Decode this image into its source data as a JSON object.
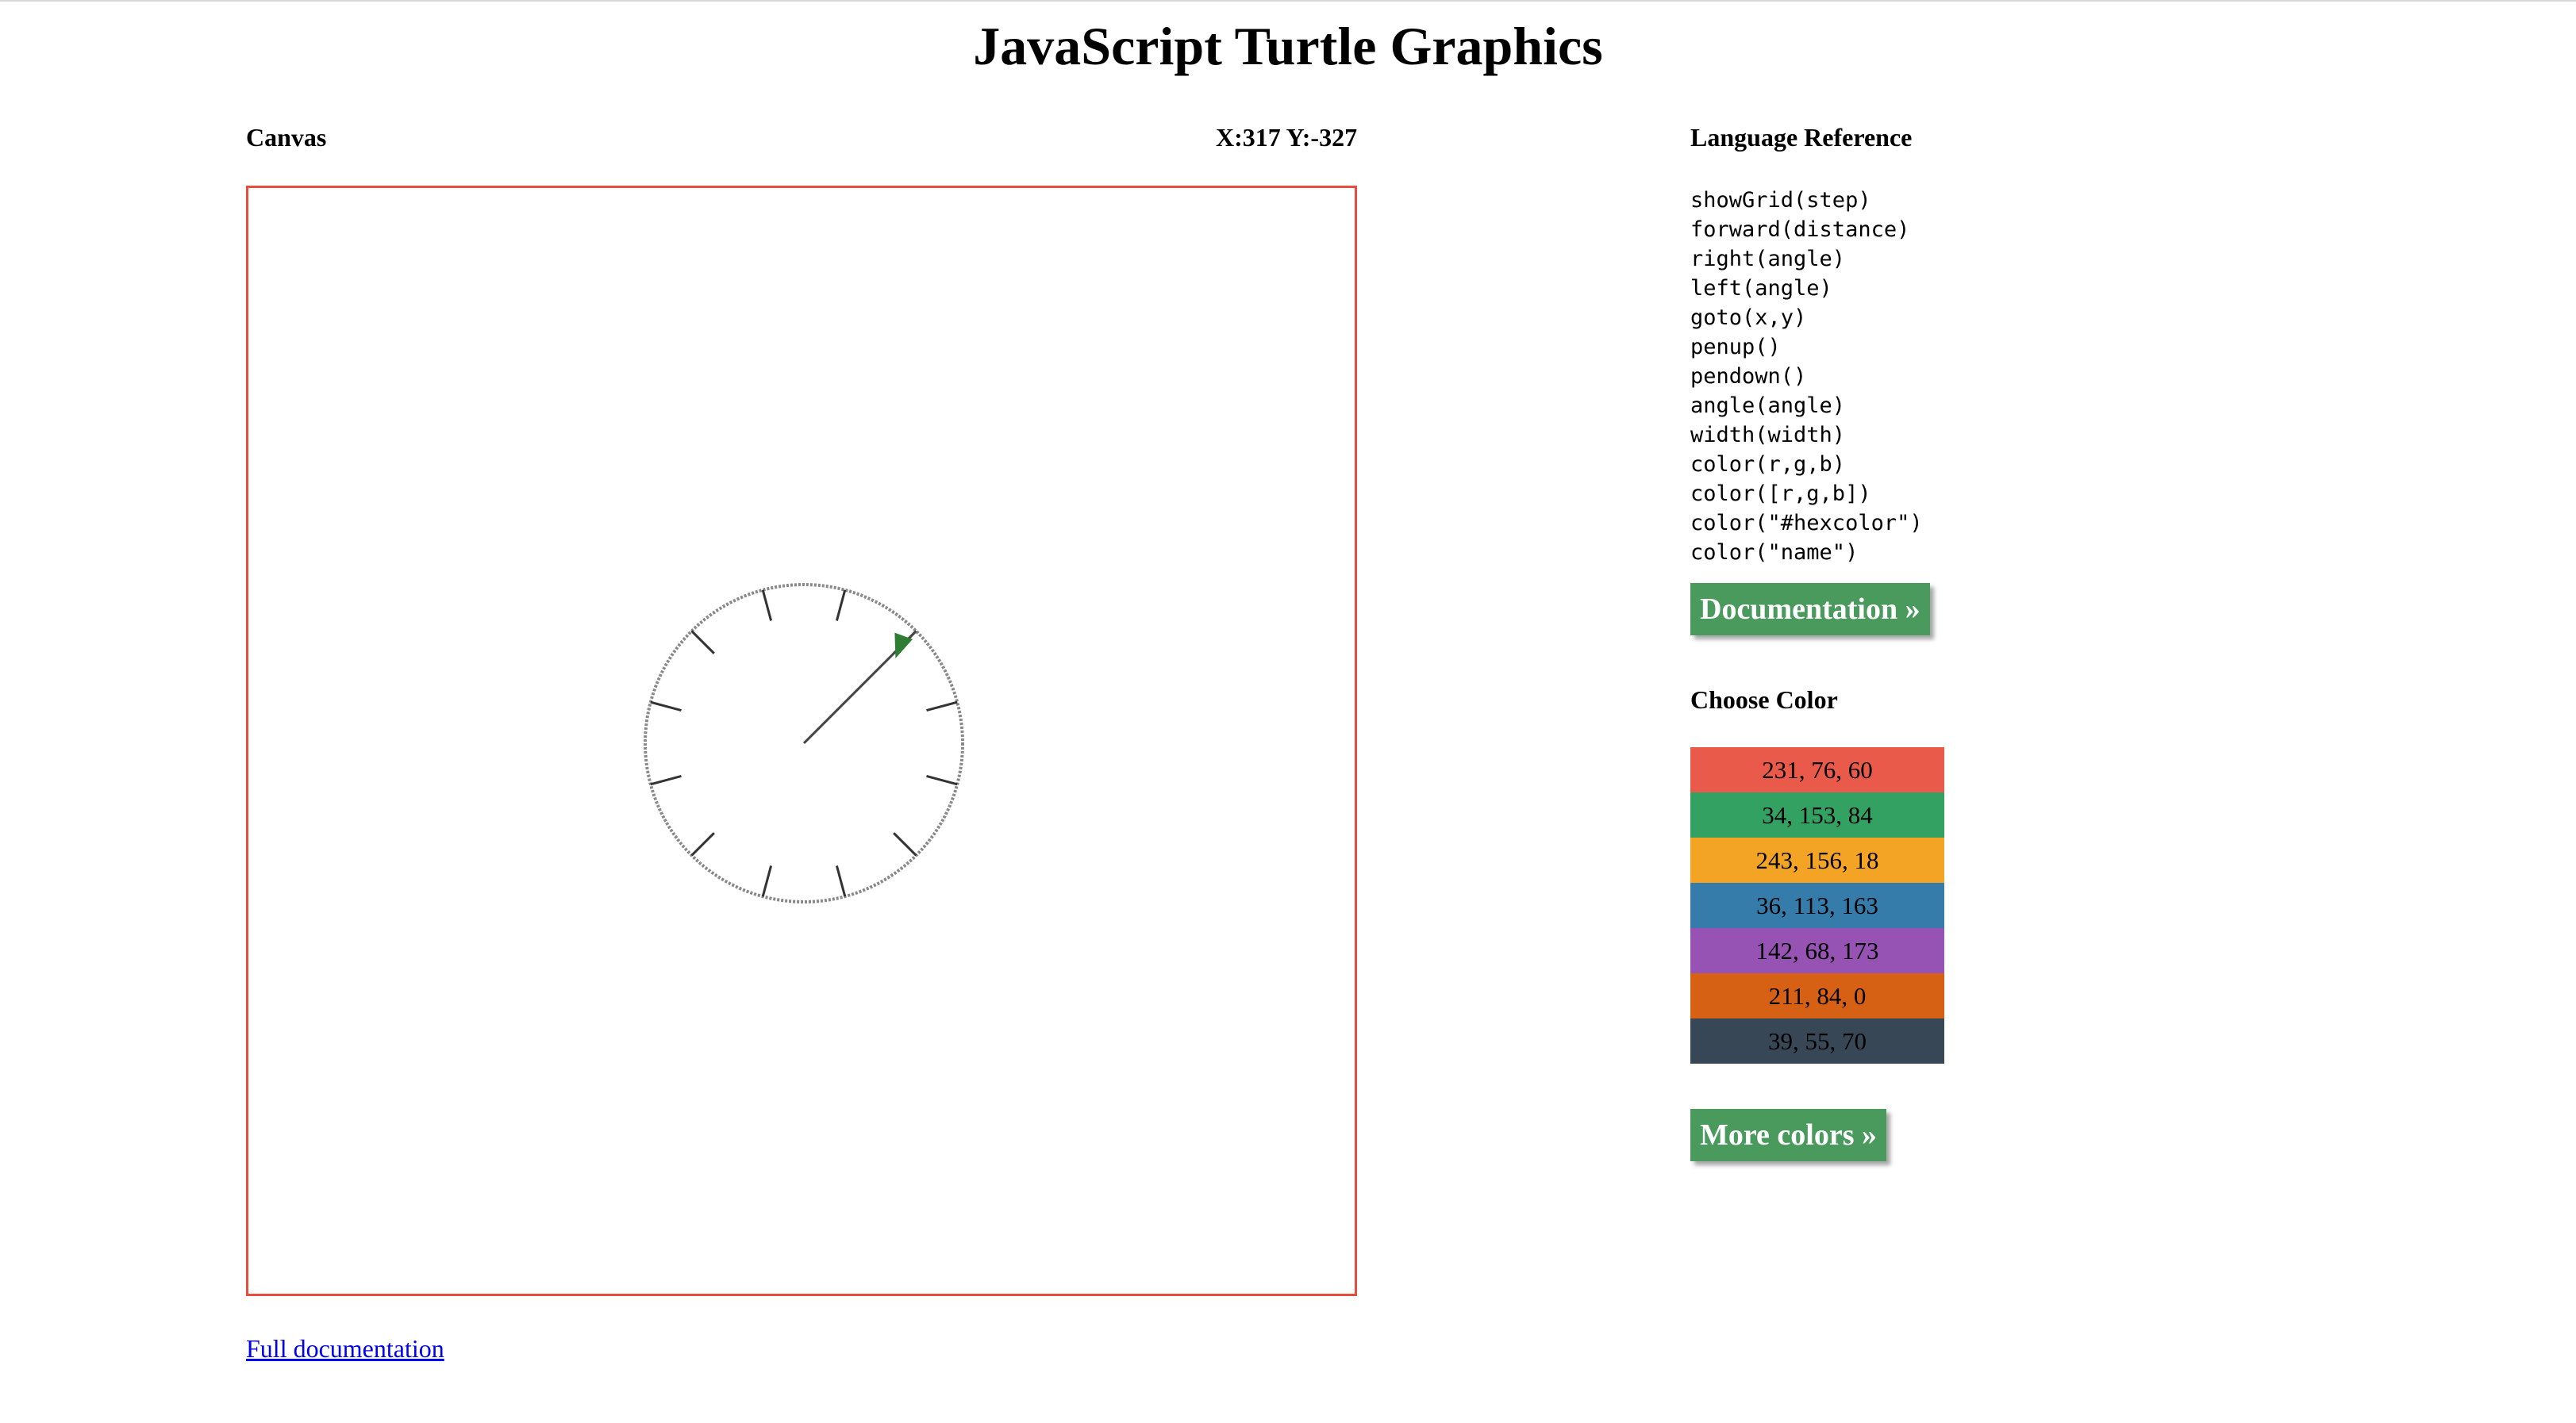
{
  "page": {
    "title": "JavaScript Turtle Graphics"
  },
  "canvas": {
    "heading": "Canvas",
    "coords": "X:317 Y:-327"
  },
  "footer": {
    "link": "Full documentation"
  },
  "reference": {
    "heading": "Language Reference",
    "items": [
      "showGrid(step)",
      "forward(distance)",
      "right(angle)",
      "left(angle)",
      "goto(x,y)",
      "penup()",
      "pendown()",
      "angle(angle)",
      "width(width)",
      "color(r,g,b)",
      "color([r,g,b])",
      "color(\"#hexcolor\")",
      "color(\"name\")"
    ],
    "doc_button": "Documentation »"
  },
  "colors": {
    "heading": "Choose Color",
    "swatches": [
      {
        "label": "231, 76, 60",
        "hex": "#e74c3c"
      },
      {
        "label": "34, 153, 84",
        "hex": "#229954"
      },
      {
        "label": "243, 156, 18",
        "hex": "#f39c12"
      },
      {
        "label": "36, 113, 163",
        "hex": "#2471a3"
      },
      {
        "label": "142, 68, 173",
        "hex": "#8e44ad"
      },
      {
        "label": "211, 84, 0",
        "hex": "#d35400"
      },
      {
        "label": "39, 55, 70",
        "hex": "#273746"
      }
    ],
    "more_button": "More colors »"
  },
  "theme": {
    "accent": "#4a9a5e",
    "canvas_border": "#e74c3c",
    "turtle": "#2e7d32"
  }
}
